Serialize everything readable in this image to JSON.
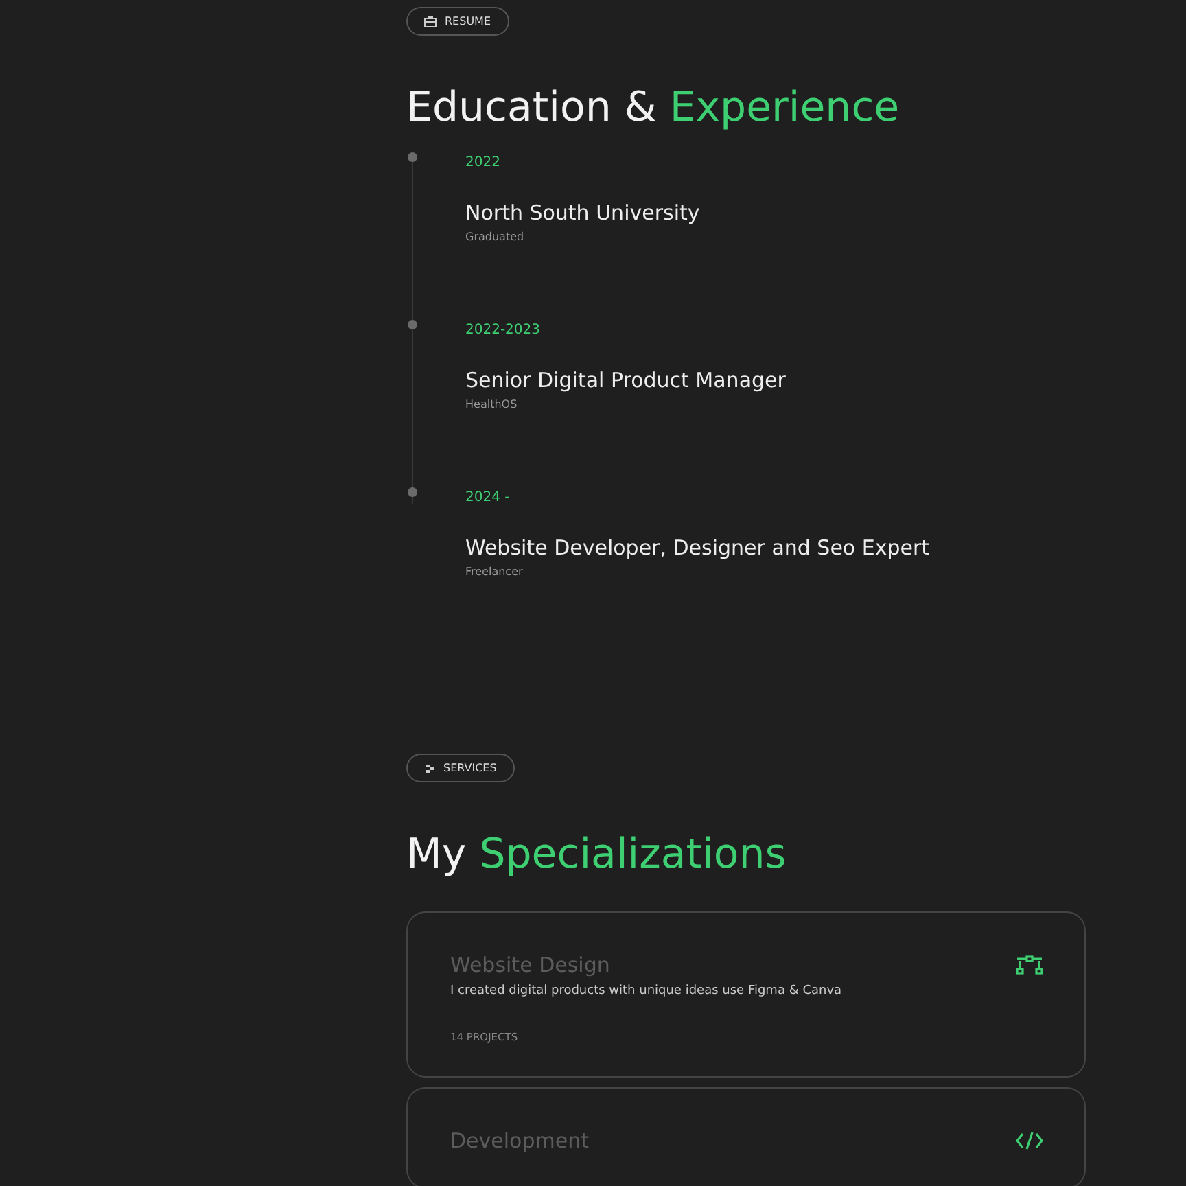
{
  "resume": {
    "badge": "RESUME",
    "heading": "Education &",
    "heading_accent": "Experience",
    "timeline": [
      {
        "period": "2022",
        "title": "North South University",
        "subtitle": "Graduated"
      },
      {
        "period": "2022-2023",
        "title": "Senior Digital Product Manager",
        "subtitle": "HealthOS"
      },
      {
        "period": "2024 -",
        "title": "Website Developer, Designer and Seo Expert",
        "subtitle": "Freelancer"
      }
    ]
  },
  "services": {
    "badge": "SERVICES",
    "heading": "My",
    "heading_accent": "Specializations",
    "cards": [
      {
        "kind": "design",
        "title": "Website Design",
        "description": "I created digital products with unique ideas use Figma & Canva",
        "count": "14 PROJECTS"
      },
      {
        "kind": "code",
        "title": "Development"
      }
    ]
  }
}
